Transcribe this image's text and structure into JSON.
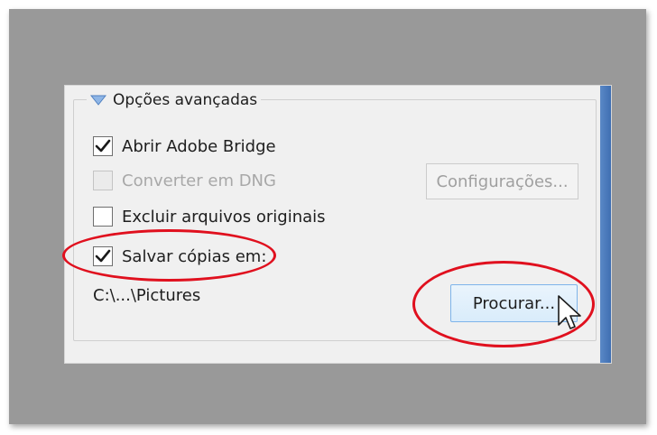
{
  "group": {
    "title": "Opções avançadas",
    "collapse_icon": "triangle-down-icon"
  },
  "options": {
    "open_bridge": {
      "label": "Abrir Adobe Bridge",
      "checked": true,
      "enabled": true
    },
    "convert_dng": {
      "label": "Converter em DNG",
      "checked": false,
      "enabled": false
    },
    "delete_originals": {
      "label": "Excluir arquivos originais",
      "checked": false,
      "enabled": true
    },
    "save_copies": {
      "label": "Salvar cópias em:",
      "checked": true,
      "enabled": true
    }
  },
  "buttons": {
    "settings_label": "Configurações...",
    "browse_label": "Procurar..."
  },
  "save_path": "C:\\...\\Pictures",
  "annotations": {
    "highlight_color": "#e0101e",
    "cursor": "mouse-pointer-icon"
  }
}
